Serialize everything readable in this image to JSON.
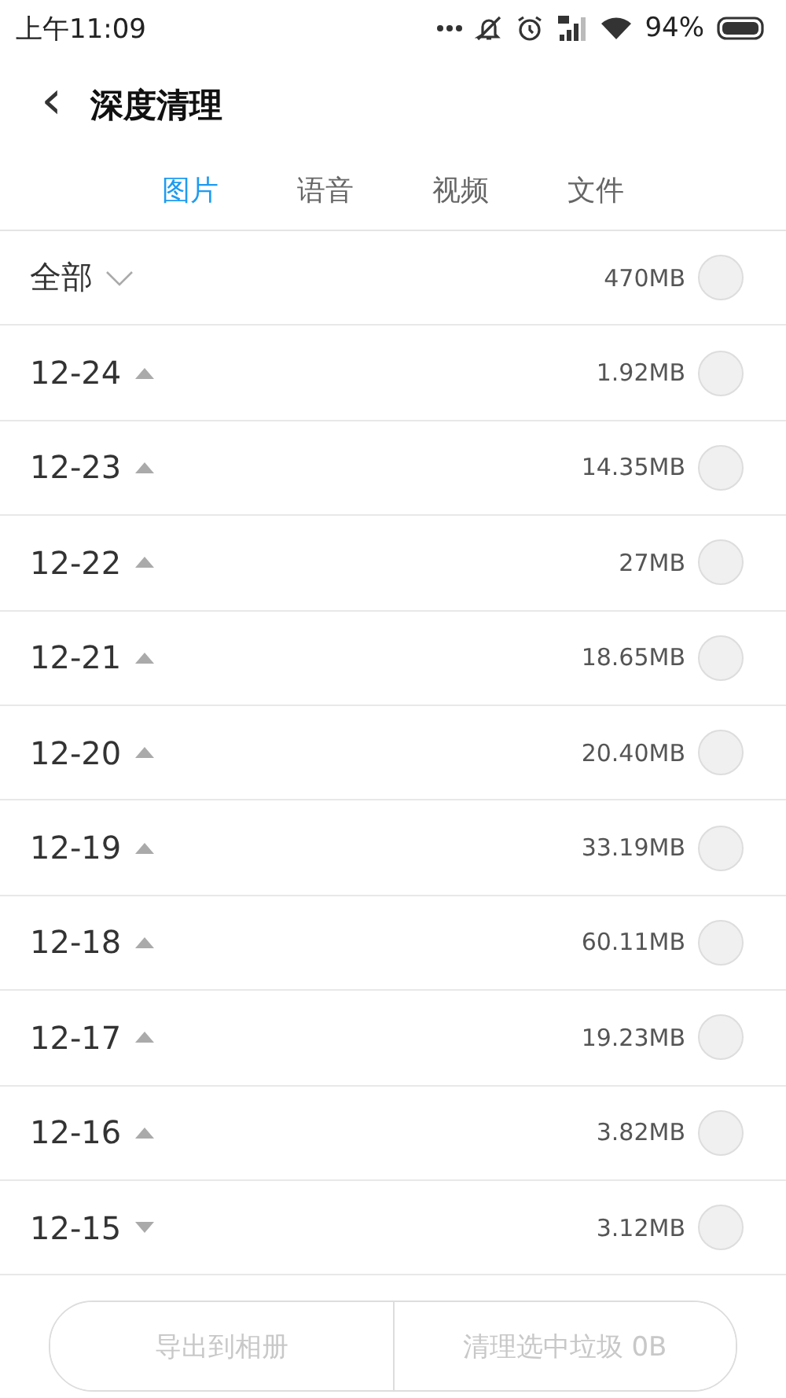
{
  "status_bar": {
    "time": "上午11:09",
    "battery": "94%"
  },
  "header": {
    "back": "‹",
    "title": "深度清理"
  },
  "tabs": [
    {
      "label": "图片",
      "selected": true
    },
    {
      "label": "语音",
      "selected": false
    },
    {
      "label": "视频",
      "selected": false
    },
    {
      "label": "文件",
      "selected": false
    }
  ],
  "summary": {
    "label": "全部",
    "size": "470MB",
    "checked": false
  },
  "groups": [
    {
      "date": "12-24",
      "size": "1.92MB",
      "expanded": false,
      "checked": false
    },
    {
      "date": "12-23",
      "size": "14.35MB",
      "expanded": false,
      "checked": false
    },
    {
      "date": "12-22",
      "size": "27MB",
      "expanded": false,
      "checked": false
    },
    {
      "date": "12-21",
      "size": "18.65MB",
      "expanded": false,
      "checked": false
    },
    {
      "date": "12-20",
      "size": "20.40MB",
      "expanded": false,
      "checked": false
    },
    {
      "date": "12-19",
      "size": "33.19MB",
      "expanded": false,
      "checked": false
    },
    {
      "date": "12-18",
      "size": "60.11MB",
      "expanded": false,
      "checked": false
    },
    {
      "date": "12-17",
      "size": "19.23MB",
      "expanded": false,
      "checked": false
    },
    {
      "date": "12-16",
      "size": "3.82MB",
      "expanded": false,
      "checked": false
    },
    {
      "date": "12-15",
      "size": "3.12MB",
      "expanded": true,
      "checked": false
    }
  ],
  "buttons": [
    {
      "label": "导出到相册",
      "disabled": true
    },
    {
      "label": "清理选中垃圾 0B",
      "disabled": true
    }
  ]
}
